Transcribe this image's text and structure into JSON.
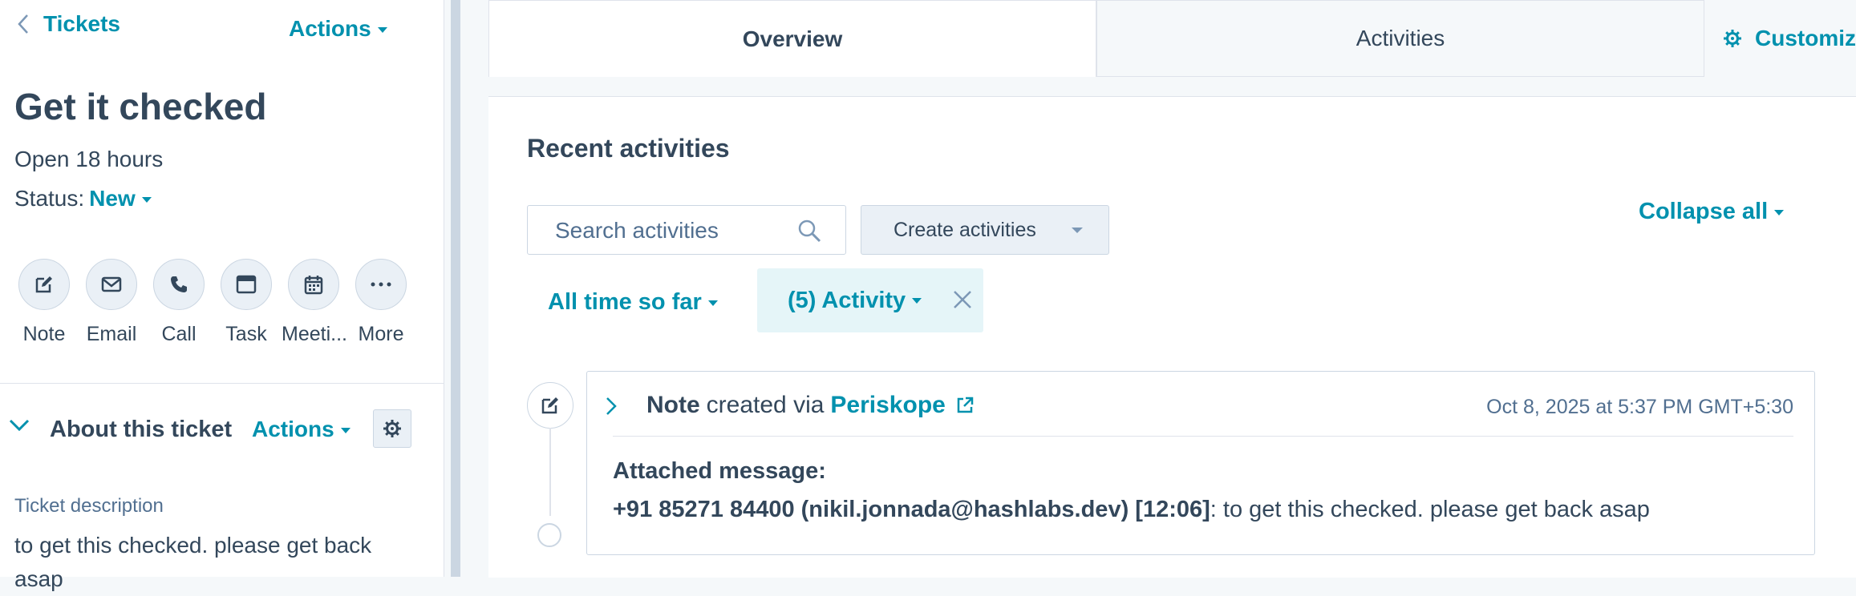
{
  "colors": {
    "accent": "#0091ae",
    "text": "#33475b",
    "muted": "#516f90",
    "border": "#cbd6e2"
  },
  "sidebar": {
    "back_label": "Tickets",
    "actions_label": "Actions",
    "title": "Get it checked",
    "open_time": "Open 18 hours",
    "status_label": "Status:",
    "status_value": "New",
    "quick_actions": [
      {
        "label": "Note",
        "icon": "note-icon"
      },
      {
        "label": "Email",
        "icon": "email-icon"
      },
      {
        "label": "Call",
        "icon": "call-icon"
      },
      {
        "label": "Task",
        "icon": "task-icon"
      },
      {
        "label": "Meeti...",
        "icon": "meeting-icon"
      },
      {
        "label": "More",
        "icon": "more-icon"
      }
    ],
    "about": {
      "title": "About this ticket",
      "actions_label": "Actions",
      "description_label": "Ticket description",
      "description_value": "to get this checked. please get back asap"
    }
  },
  "tabs": {
    "overview": "Overview",
    "activities": "Activities",
    "customize": "Customiz"
  },
  "main": {
    "recent_title": "Recent activities",
    "search_placeholder": "Search activities",
    "create_label": "Create activities",
    "collapse_label": "Collapse all",
    "time_filter": "All time so far",
    "activity_filter": "(5) Activity",
    "note": {
      "type": "Note",
      "created_via": "created via",
      "source": "Periskope",
      "timestamp": "Oct 8, 2025 at 5:37 PM GMT+5:30",
      "attached_label": "Attached message:",
      "sender": "+91 85271 84400 (nikil.jonnada@hashlabs.dev) [12:06]",
      "message": ": to get this checked. please get back asap"
    }
  }
}
